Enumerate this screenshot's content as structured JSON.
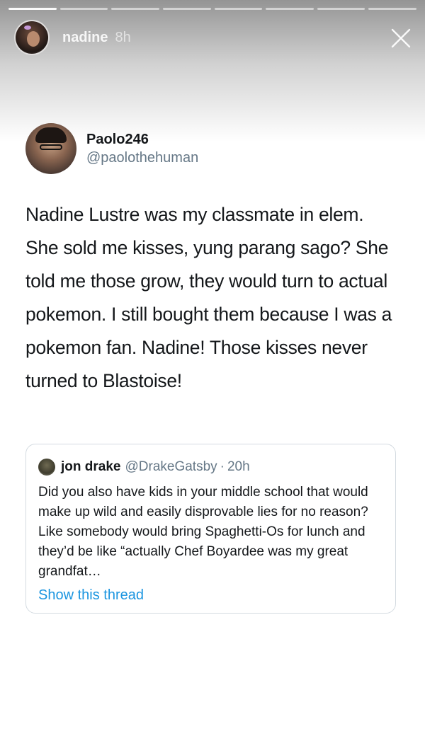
{
  "story": {
    "username": "nadine",
    "time": "8h",
    "progress": {
      "segments": 8,
      "completed": 1
    }
  },
  "tweet": {
    "display_name": "Paolo246",
    "handle": "@paolothehuman",
    "text": "Nadine Lustre was my classmate in elem. She sold me kisses, yung parang sago? She told me those grow, they would turn to actual pokemon. I still bought them because I was a pokemon fan. Nadine! Those kisses never turned to Blastoise!"
  },
  "quoted_tweet": {
    "display_name": "jon drake",
    "handle": "@DrakeGatsby",
    "separator": "·",
    "time": "20h",
    "text": "Did you also have kids in your middle school that would make up wild and easily disprovable lies for no reason? Like somebody would bring Spaghetti-Os for lunch and they’d be like “actually Chef Boyardee was my great grandfat…",
    "link_label": "Show this thread"
  },
  "colors": {
    "link": "#1b95e0",
    "secondary_text": "#657786",
    "primary_text": "#14171a",
    "border": "#d4dbe1"
  }
}
